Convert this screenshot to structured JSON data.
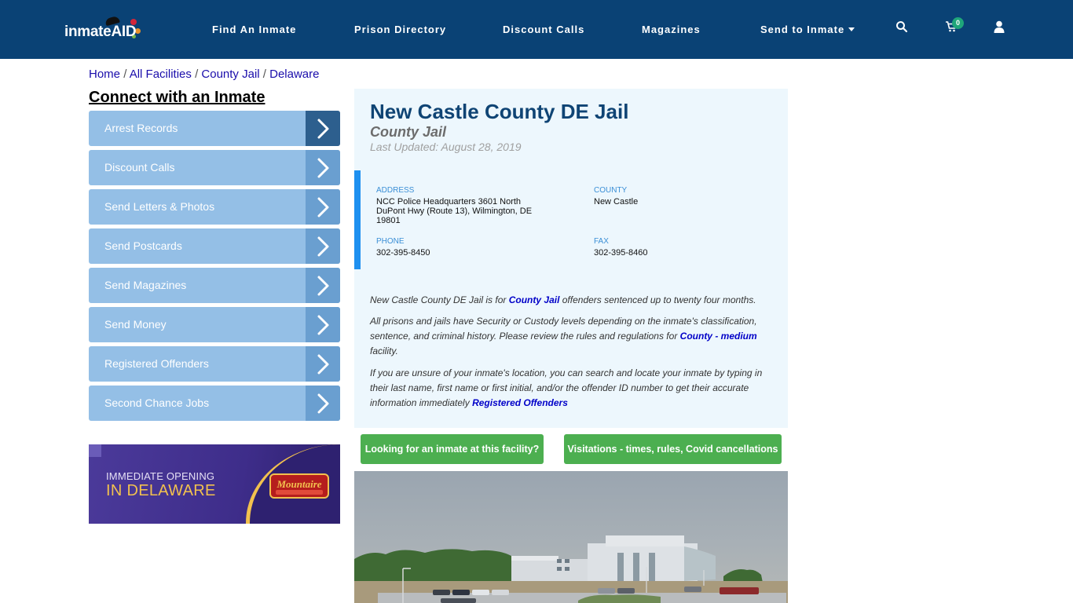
{
  "header": {
    "logo": {
      "text_inmate": "inmate",
      "text_aid": "AID"
    },
    "nav": [
      {
        "label": "Find An Inmate"
      },
      {
        "label": "Prison Directory"
      },
      {
        "label": "Discount Calls"
      },
      {
        "label": "Magazines"
      },
      {
        "label": "Send to Inmate",
        "has_dropdown": true
      }
    ],
    "icons": {
      "search": "search-icon",
      "cart": "cart-icon",
      "user": "user-icon"
    },
    "cart_count": "0"
  },
  "breadcrumb": [
    {
      "label": "Home"
    },
    {
      "label": "All Facilities"
    },
    {
      "label": "County Jail"
    },
    {
      "label": "Delaware"
    }
  ],
  "breadcrumb_separator": "/",
  "sidebar": {
    "title": "Connect with an Inmate",
    "items": [
      {
        "label": "Arrest Records",
        "active": true
      },
      {
        "label": "Discount Calls"
      },
      {
        "label": "Send Letters & Photos"
      },
      {
        "label": "Send Postcards"
      },
      {
        "label": "Send Magazines"
      },
      {
        "label": "Send Money"
      },
      {
        "label": "Registered Offenders"
      },
      {
        "label": "Second Chance Jobs"
      }
    ],
    "ad": {
      "line1": "IMMEDIATE OPENING",
      "line2": "IN DELAWARE",
      "brand": "Mountaire"
    }
  },
  "facility": {
    "name": "New Castle County DE Jail",
    "type": "County Jail",
    "last_updated": "Last Updated: August 28, 2019",
    "address_label": "ADDRESS",
    "address_line1": "NCC Police Headquarters 3601 North",
    "address_line2": "DuPont Hwy (Route 13), Wilmington, DE",
    "address_line3": "19801",
    "county_label": "COUNTY",
    "county": "New Castle",
    "phone_label": "PHONE",
    "phone": "302-395-8450",
    "fax_label": "FAX",
    "fax": "302-395-8460"
  },
  "description": {
    "p1_before": "New Castle County DE Jail is for ",
    "p1_link": "County Jail",
    "p1_after": " offenders sentenced up to twenty four months.",
    "p2_before": "All prisons and jails have Security or Custody levels depending on the inmate's classification, sentence, and criminal history. Please review the rules and regulations for ",
    "p2_link": "County - medium",
    "p2_after": " facility.",
    "p3_before": "If you are unsure of your inmate's location, you can search and locate your inmate by typing in their last name, first name or first initial, and/or the offender ID number to get their accurate information immediately ",
    "p3_link": "Registered Offenders"
  },
  "buttons": {
    "find_inmate": "Looking for an inmate at this facility?",
    "visitation": "Visitations - times, rules, Covid cancellations"
  },
  "colors": {
    "header_bg": "#0a4275",
    "sidebar_item": "#94bfe6",
    "sidebar_arrow": "#6a9fd0",
    "sidebar_arrow_active": "#2d5f8e",
    "title": "#0f4474",
    "button_green": "#4caf50",
    "card_bg": "#edf7fd",
    "accent_bar": "#1e90f0"
  }
}
